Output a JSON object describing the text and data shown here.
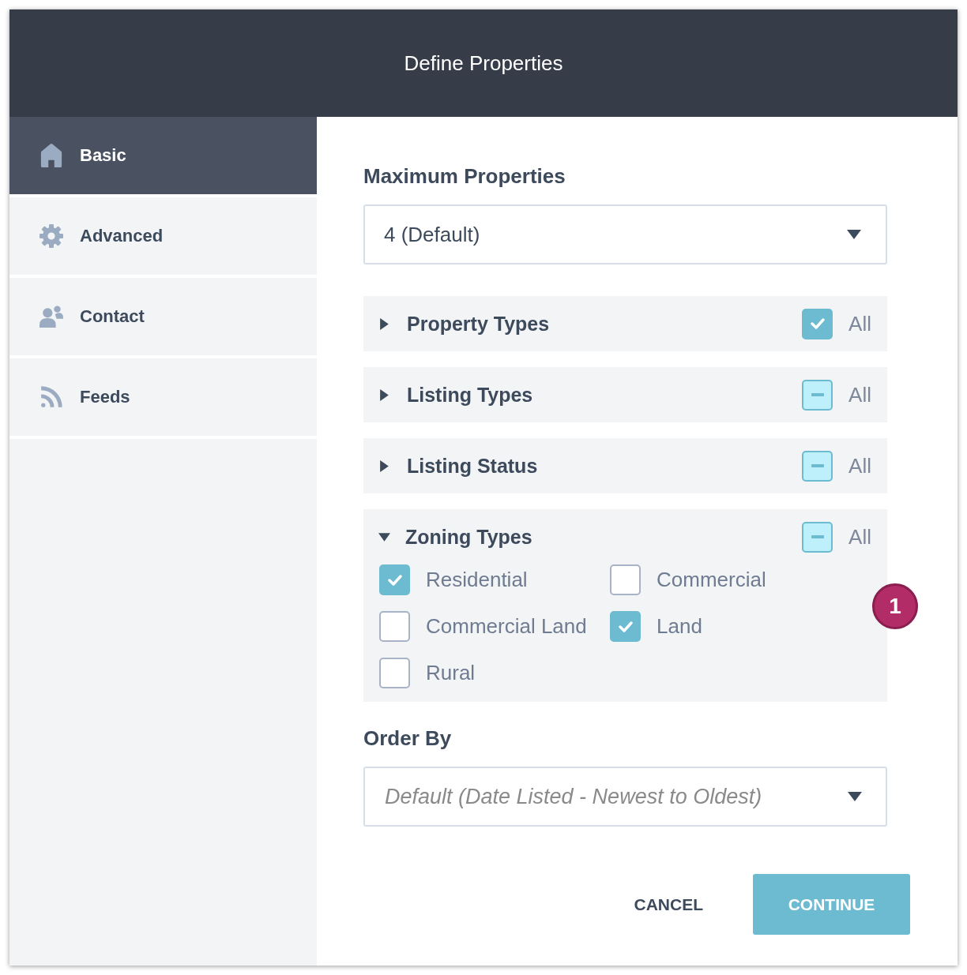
{
  "dialog": {
    "title": "Define Properties"
  },
  "sidebar": {
    "items": [
      {
        "label": "Basic",
        "selected": true
      },
      {
        "label": "Advanced",
        "selected": false
      },
      {
        "label": "Contact",
        "selected": false
      },
      {
        "label": "Feeds",
        "selected": false
      }
    ]
  },
  "max_properties": {
    "label": "Maximum Properties",
    "value": "4 (Default)"
  },
  "filters": [
    {
      "title": "Property Types",
      "expanded": false,
      "all": {
        "label": "All",
        "checked": true,
        "indeterminate": false
      }
    },
    {
      "title": "Listing Types",
      "expanded": false,
      "all": {
        "label": "All",
        "checked": false,
        "indeterminate": true
      }
    },
    {
      "title": "Listing Status",
      "expanded": false,
      "all": {
        "label": "All",
        "checked": false,
        "indeterminate": true
      }
    },
    {
      "title": "Zoning Types",
      "expanded": true,
      "all": {
        "label": "All",
        "checked": false,
        "indeterminate": true
      },
      "options": [
        {
          "label": "Residential",
          "checked": true
        },
        {
          "label": "Commercial",
          "checked": false
        },
        {
          "label": "Commercial Land",
          "checked": false
        },
        {
          "label": "Land",
          "checked": true
        },
        {
          "label": "Rural",
          "checked": false
        }
      ]
    }
  ],
  "order_by": {
    "label": "Order By",
    "placeholder": "Default (Date Listed - Newest to Oldest)"
  },
  "buttons": [
    {
      "label": "CANCEL",
      "kind": "text"
    },
    {
      "label": "CONTINUE",
      "kind": "primary"
    }
  ],
  "callout": {
    "label": "1"
  }
}
